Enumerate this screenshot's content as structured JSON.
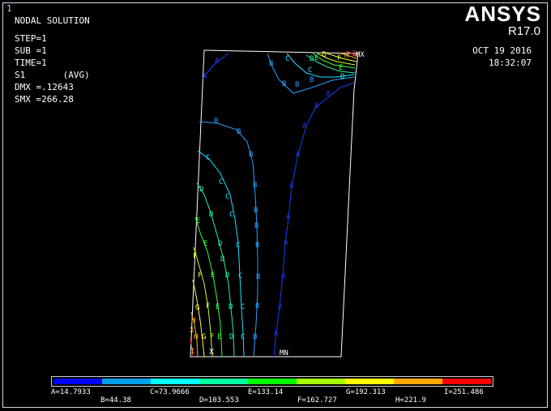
{
  "window": {
    "number": "1"
  },
  "header": {
    "title": "NODAL SOLUTION"
  },
  "info": {
    "step": "STEP=1",
    "sub": "SUB =1",
    "time": "TIME=1",
    "result": "S1       (AVG)",
    "dmx": "DMX =.12643",
    "smx": "SMX =266.28"
  },
  "brand": {
    "name": "ANSYS",
    "version": "R17.0"
  },
  "stamp": {
    "date": "OCT 19 2016",
    "time": "18:32:07"
  },
  "markers": {
    "max": "MX",
    "min": "MN",
    "node_x": "X"
  },
  "legend": {
    "colors": [
      "#0000ff",
      "#00a0e8",
      "#00ffff",
      "#00ffa0",
      "#00ff00",
      "#a8ff00",
      "#ffff00",
      "#ffa800",
      "#ff0000"
    ],
    "labels_row1": [
      "A=14.7933",
      "C=73.9666",
      "E=133.14",
      "G=192.313",
      "I=251.486"
    ],
    "labels_row2": [
      "B=44.38",
      "D=103.553",
      "F=162.727",
      "H=221.9"
    ]
  },
  "contour_colors": {
    "A": "#1a3cff",
    "B": "#2aa0ff",
    "C": "#1fe0ff",
    "D": "#22f5a8",
    "E": "#33ff44",
    "F": "#c8ff2a",
    "G": "#ffff40",
    "H": "#ffb030",
    "I": "#ff3030"
  }
}
